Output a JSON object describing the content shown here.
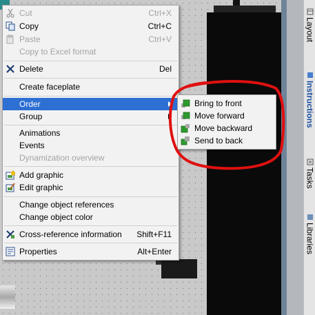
{
  "context_menu": {
    "items": [
      {
        "id": "cut",
        "label": "Cut",
        "shortcut": "Ctrl+X",
        "disabled": true,
        "icon": "scissors-icon"
      },
      {
        "id": "copy",
        "label": "Copy",
        "shortcut": "Ctrl+C",
        "disabled": false,
        "icon": "copy-icon"
      },
      {
        "id": "paste",
        "label": "Paste",
        "shortcut": "Ctrl+V",
        "disabled": true,
        "icon": "paste-icon"
      },
      {
        "id": "copy_excel",
        "label": "Copy to Excel format",
        "shortcut": "",
        "disabled": true,
        "icon": ""
      },
      {
        "id": "delete",
        "label": "Delete",
        "shortcut": "Del",
        "disabled": false,
        "icon": "delete-x-icon"
      },
      {
        "id": "create_faceplate",
        "label": "Create faceplate",
        "shortcut": "",
        "disabled": false,
        "icon": ""
      },
      {
        "id": "order",
        "label": "Order",
        "shortcut": "",
        "disabled": false,
        "highlighted": true,
        "submenu": true
      },
      {
        "id": "group",
        "label": "Group",
        "shortcut": "",
        "disabled": false,
        "submenu": true
      },
      {
        "id": "animations",
        "label": "Animations",
        "shortcut": "",
        "disabled": false
      },
      {
        "id": "events",
        "label": "Events",
        "shortcut": "",
        "disabled": false
      },
      {
        "id": "dynamization",
        "label": "Dynamization overview",
        "shortcut": "",
        "disabled": true
      },
      {
        "id": "add_graphic",
        "label": "Add graphic",
        "shortcut": "",
        "disabled": false,
        "icon": "add-graphic-icon"
      },
      {
        "id": "edit_graphic",
        "label": "Edit graphic",
        "shortcut": "",
        "disabled": false,
        "icon": "edit-graphic-icon"
      },
      {
        "id": "change_refs",
        "label": "Change object references",
        "shortcut": "",
        "disabled": false
      },
      {
        "id": "change_color",
        "label": "Change object color",
        "shortcut": "",
        "disabled": false
      },
      {
        "id": "cross_ref",
        "label": "Cross-reference information",
        "shortcut": "Shift+F11",
        "disabled": false,
        "icon": "cross-reference-icon"
      },
      {
        "id": "properties",
        "label": "Properties",
        "shortcut": "Alt+Enter",
        "disabled": false,
        "icon": "properties-icon"
      }
    ]
  },
  "submenu": {
    "items": [
      {
        "id": "bring_front",
        "label": "Bring to front",
        "icon": "bring-to-front-icon"
      },
      {
        "id": "move_forward",
        "label": "Move forward",
        "icon": "move-forward-icon"
      },
      {
        "id": "move_backward",
        "label": "Move backward",
        "icon": "move-backward-icon"
      },
      {
        "id": "send_back",
        "label": "Send to back",
        "icon": "send-to-back-icon"
      }
    ]
  },
  "side_tabs": [
    "Layout",
    "Instructions",
    "Tasks",
    "Libraries"
  ],
  "colors": {
    "highlight": "#2d6fd2",
    "annotation": "#e01010",
    "menu_bg": "#f2f2f2",
    "disabled_text": "#a3a3a3",
    "icon_green": "#2e9a2e"
  }
}
